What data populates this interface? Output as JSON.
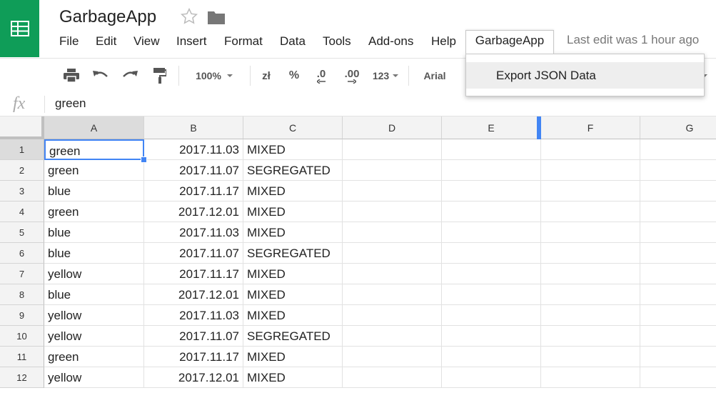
{
  "app": {
    "title": "GarbageApp",
    "last_edit": "Last edit was 1 hour ago",
    "colors": {
      "logo_bg": "#0f9d58",
      "selection": "#4285f4"
    }
  },
  "menu": {
    "items": [
      "File",
      "Edit",
      "View",
      "Insert",
      "Format",
      "Data",
      "Tools",
      "Add-ons",
      "Help",
      "GarbageApp"
    ],
    "active": "GarbageApp",
    "dropdown": {
      "items": [
        "Export JSON Data"
      ]
    }
  },
  "toolbar": {
    "icons": [
      "print-icon",
      "undo-icon",
      "redo-icon",
      "paint-format-icon"
    ],
    "zoom": "100%",
    "currency": "zł",
    "percent": "%",
    "decrease_decimal": ".0",
    "increase_decimal": ".00",
    "number_format": "123",
    "font": "Arial"
  },
  "formula_bar": {
    "label": "fx",
    "value": "green"
  },
  "sheet": {
    "columns": [
      "A",
      "B",
      "C",
      "D",
      "E",
      "F",
      "G"
    ],
    "selected_cell": "A1",
    "rows": [
      {
        "num": "1",
        "a": "green",
        "b": "2017.11.03",
        "c": "MIXED"
      },
      {
        "num": "2",
        "a": "green",
        "b": "2017.11.07",
        "c": "SEGREGATED"
      },
      {
        "num": "3",
        "a": "blue",
        "b": "2017.11.17",
        "c": "MIXED"
      },
      {
        "num": "4",
        "a": "green",
        "b": "2017.12.01",
        "c": "MIXED"
      },
      {
        "num": "5",
        "a": "blue",
        "b": "2017.11.03",
        "c": "MIXED"
      },
      {
        "num": "6",
        "a": "blue",
        "b": "2017.11.07",
        "c": "SEGREGATED"
      },
      {
        "num": "7",
        "a": "yellow",
        "b": "2017.11.17",
        "c": "MIXED"
      },
      {
        "num": "8",
        "a": "blue",
        "b": "2017.12.01",
        "c": "MIXED"
      },
      {
        "num": "9",
        "a": "yellow",
        "b": "2017.11.03",
        "c": "MIXED"
      },
      {
        "num": "10",
        "a": "yellow",
        "b": "2017.11.07",
        "c": "SEGREGATED"
      },
      {
        "num": "11",
        "a": "green",
        "b": "2017.11.17",
        "c": "MIXED"
      },
      {
        "num": "12",
        "a": "yellow",
        "b": "2017.12.01",
        "c": "MIXED"
      }
    ]
  }
}
